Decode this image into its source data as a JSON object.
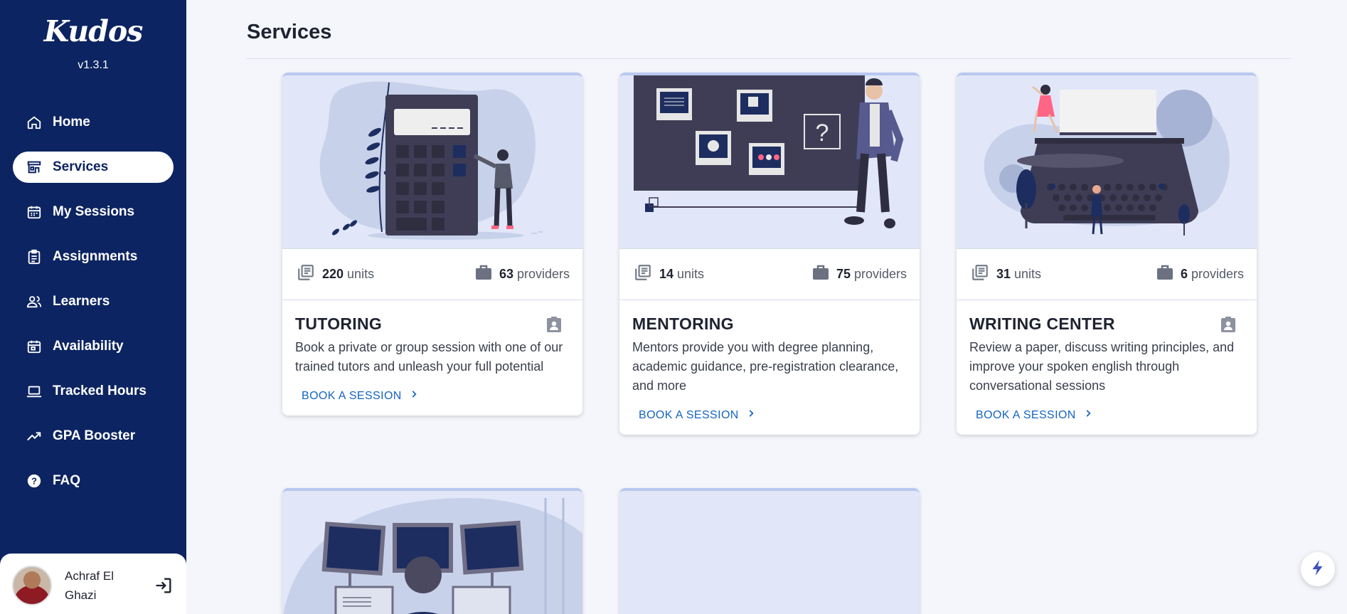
{
  "app": {
    "logo": "Kudos",
    "version": "v1.3.1"
  },
  "sidebar": {
    "items": [
      {
        "label": "Home",
        "icon": "home-icon"
      },
      {
        "label": "Services",
        "icon": "store-icon",
        "active": true
      },
      {
        "label": "My Sessions",
        "icon": "calendar-icon"
      },
      {
        "label": "Assignments",
        "icon": "clipboard-icon"
      },
      {
        "label": "Learners",
        "icon": "people-icon"
      },
      {
        "label": "Availability",
        "icon": "calendar-check-icon"
      },
      {
        "label": "Tracked Hours",
        "icon": "laptop-icon"
      },
      {
        "label": "GPA Booster",
        "icon": "trending-up-icon"
      },
      {
        "label": "FAQ",
        "icon": "help-circle-icon"
      }
    ]
  },
  "user": {
    "name": "Achraf El Ghazi",
    "logout_icon": "logout-icon"
  },
  "page": {
    "title": "Services"
  },
  "services": [
    {
      "title": "TUTORING",
      "units": "220",
      "units_label": "units",
      "providers": "63",
      "providers_label": "providers",
      "description": "Book a private or group session with one of our trained tutors and unleash your full potential",
      "cta": "BOOK A SESSION",
      "has_badge": true
    },
    {
      "title": "MENTORING",
      "units": "14",
      "units_label": "units",
      "providers": "75",
      "providers_label": "providers",
      "description": "Mentors provide you with degree planning, academic guidance, pre-registration clearance, and more",
      "cta": "BOOK A SESSION",
      "has_badge": false
    },
    {
      "title": "WRITING CENTER",
      "units": "31",
      "units_label": "units",
      "providers": "6",
      "providers_label": "providers",
      "description": "Review a paper, discuss writing principles, and improve your spoken english through conversational sessions",
      "cta": "BOOK A SESSION",
      "has_badge": true
    }
  ],
  "colors": {
    "sidebar": "#0c2461",
    "accent": "#1565c0",
    "hero": "#e1e7f8",
    "illustration_dark": "#3f3d56"
  }
}
